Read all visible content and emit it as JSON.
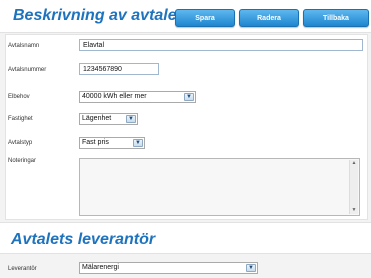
{
  "description_section": {
    "title": "Beskrivning av avtalet",
    "buttons": {
      "save_label": "Spara",
      "delete_label": "Radera",
      "back_label": "Tillbaka"
    }
  },
  "form": {
    "agreement_name": {
      "label": "Avtalsnamn",
      "value": "Elavtal"
    },
    "agreement_number": {
      "label": "Avtalsnummer",
      "value": "1234567890"
    },
    "power_need": {
      "label": "Elbehov",
      "value": "40000 kWh eller mer"
    },
    "property": {
      "label": "Fastighet",
      "value": "Lägenhet"
    },
    "agreement_type": {
      "label": "Avtalstyp",
      "value": "Fast pris"
    },
    "notes": {
      "label": "Noteringar",
      "value": ""
    }
  },
  "supplier_section": {
    "title": "Avtalets leverantör",
    "supplier": {
      "label": "Leverantör",
      "value": "Mälarenergi"
    }
  },
  "colors": {
    "heading_blue": "#1e73be",
    "button_blue": "#2e94dc"
  },
  "icons": {
    "dropdown": "chevron-down-icon",
    "scroll_up": "scroll-up-icon",
    "scroll_down": "scroll-down-icon"
  }
}
